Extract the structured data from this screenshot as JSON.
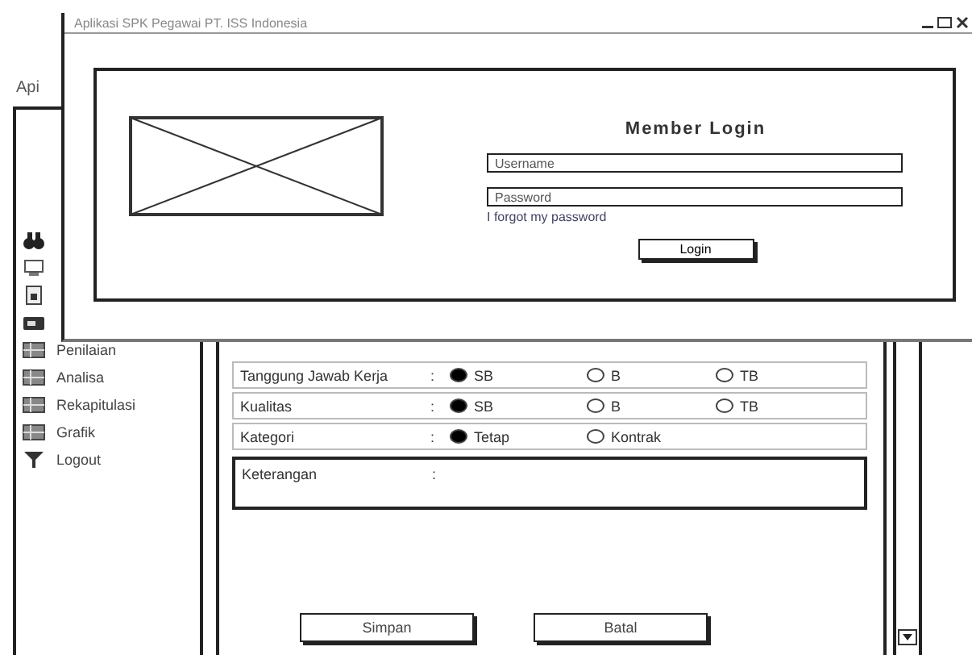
{
  "background_window": {
    "title": "Api",
    "sidebar": {
      "items": [
        {
          "kind": "icon_only"
        },
        {
          "kind": "icon_only"
        },
        {
          "kind": "icon_only"
        },
        {
          "kind": "icon_only"
        },
        {
          "kind": "labeled",
          "label": "Penilaian"
        },
        {
          "kind": "labeled",
          "label": "Analisa"
        },
        {
          "kind": "labeled",
          "label": "Rekapitulasi"
        },
        {
          "kind": "labeled",
          "label": "Grafik"
        },
        {
          "kind": "labeled",
          "label": "Logout"
        }
      ]
    },
    "form": {
      "rows": [
        {
          "kind": "radio",
          "label": "Tanggung Jawab Kerja",
          "separator": ":",
          "options": [
            {
              "label": "SB",
              "selected": true
            },
            {
              "label": "B",
              "selected": false
            },
            {
              "label": "TB",
              "selected": false
            }
          ]
        },
        {
          "kind": "radio",
          "label": "Kualitas",
          "separator": ":",
          "options": [
            {
              "label": "SB",
              "selected": true
            },
            {
              "label": "B",
              "selected": false
            },
            {
              "label": "TB",
              "selected": false
            }
          ]
        },
        {
          "kind": "radio",
          "label": "Kategori",
          "separator": ":",
          "options": [
            {
              "label": "Tetap",
              "selected": true
            },
            {
              "label": "Kontrak",
              "selected": false
            }
          ]
        },
        {
          "kind": "textarea",
          "label": "Keterangan",
          "separator": ":"
        }
      ],
      "buttons": [
        "Simpan",
        "Batal"
      ]
    }
  },
  "dialog": {
    "title": "Aplikasi SPK Pegawai PT. ISS Indonesia",
    "login": {
      "heading": "Member Login",
      "fields": [
        {
          "placeholder": "Username"
        },
        {
          "placeholder": "Password"
        }
      ],
      "link": "I forgot my password",
      "button": "Login"
    }
  }
}
